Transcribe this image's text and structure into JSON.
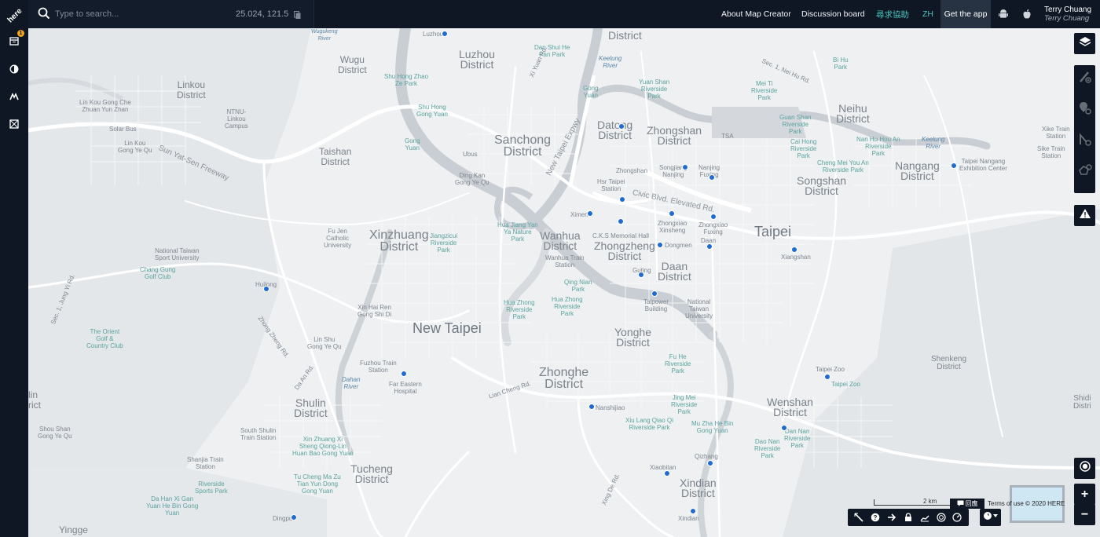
{
  "brand": {
    "logo_text": "here"
  },
  "rail": {
    "items": [
      {
        "icon": "calendar-icon",
        "badge": "1"
      },
      {
        "icon": "contrast-icon"
      },
      {
        "icon": "road-icon"
      },
      {
        "icon": "map-grid-icon"
      }
    ]
  },
  "search": {
    "placeholder": "Type to search...",
    "coords": "25.024, 121.5"
  },
  "nav": {
    "about": "About Map Creator",
    "discussion": "Discussion board",
    "help": "尋求協助",
    "lang": "ZH",
    "get_app": "Get the app"
  },
  "user": {
    "name": "Terry Chuang",
    "subtitle": "Terry Chuang"
  },
  "map": {
    "labels": {
      "district_top": "District",
      "luzhou": "Luzhou\nDistrict",
      "wugu": "Wugu\nDistrict",
      "linkou": "Linkou\nDistrict",
      "taishan": "Taishan\nDistrict",
      "sanchong": "Sanchong\nDistrict",
      "datong": "Datong\nDistrict",
      "zhongshan": "Zhongshan\nDistrict",
      "neihu": "Neihu\nDistrict",
      "nangang": "Nangang\nDistrict",
      "songshan": "Songshan\nDistrict",
      "xinzhuang": "Xinzhuang\nDistrict",
      "wanhua": "Wanhua\nDistrict",
      "zhongzheng": "Zhongzheng\nDistrict",
      "daan": "Daan\nDistrict",
      "taipei": "Taipei",
      "newtaipei": "New Taipei",
      "yonghe": "Yonghe\nDistrict",
      "zhonghe": "Zhonghe\nDistrict",
      "shulin": "Shulin\nDistrict",
      "tucheng": "Tucheng\nDistrict",
      "wenshan": "Wenshan\nDistrict",
      "xindian": "Xindian\nDistrict",
      "yingge": "Yingge",
      "shenkeng": "Shenkeng\nDistrict",
      "shiding": "Shidi\nDistri",
      "edge_left": "lin\nrict",
      "sun_yat_sen": "Sun Yat-Sen Freeway",
      "civic": "Civic Blvd. Elevated Rd.",
      "new_taipei_expwy": "New Taipei Expwy",
      "zhong_zheng_rd": "Zhong Zheng Rd.",
      "da_an_rd": "Da An Rd.",
      "lian_cheng_rd": "Lian Cheng Rd.",
      "sec1_zhongyi": "Sec. 1, Jung Yi Rd.",
      "sec1_neihu": "Sec. 1, Nei Hu Rd.",
      "xi_yuan_rd": "Xi Yuan Rd.",
      "xing_de_rd": "Xing De Rd.",
      "wugukeng": "Wugukeng\nRiver",
      "keelung": "Keelung\nRiver",
      "keelung2": "Keelung\nRiver",
      "dahan": "Dahan\nRiver",
      "lin_kou_gong_che": "Lin Kou Gong Che\nZhuan Yun Zhan",
      "ntnu_linkou": "NTNU-\nLinkou\nCampus",
      "solar_bus": "Solar Bus",
      "lin_kou_gong_ye": "Lin Kou\nGong Ye Qu",
      "shu_hong_zhao": "Shu Hong Zhao\nZe Park",
      "shu_hong_gong": "Shu Hong\nGong Yuan",
      "gong_yuan": "Gong\nYuan",
      "dan_shui_he": "Dan Shui He\nPan Park",
      "luzhou_st": "Luzhou",
      "ubus": "Ubus",
      "ding_kan": "Ding Kan\nGong Ye Qu",
      "gong_yuan2": "Gong\nYuan",
      "yuan_shan": "Yuan Shan\nRiverside\nPark",
      "mei_ti": "Mei Ti\nRiverside\nPark",
      "bi_hu": "Bi Hu\nPark",
      "guan_shan": "Guan Shan\nRiverside\nPark",
      "cai_hong": "Cai Hong\nRiverside\nPark",
      "nan_hu_hou_an": "Nan Hu Hou An\nRiverside\nPark",
      "cheng_mei": "Cheng Mei You An\nRiverside Park",
      "taipei_nangang": "Taipei Nangang\nExhibition Center",
      "xike": "Xike Train\nStation",
      "sike": "Sike Train\nStation",
      "tsa": "TSA",
      "zhongshan_st": "Zhongshan",
      "songjiang": "Songjiang\nNanjing",
      "nanjing_fuxing": "Nanjing\nFuxing",
      "hsr": "Hsr Taipei\nStation",
      "ximen": "Ximen",
      "zhongxiao_xinsheng": "Zhongxiao\nXinsheng",
      "zhongxiao_fuxing": "Zhongxiao\nFuxing",
      "daan_st": "Daan",
      "dongmen": "Dongmen",
      "ck_memorial": "C.K.S Memorial Hall",
      "xiangshan": "Xiangshan",
      "guting": "Guting",
      "taipower": "Taipower\nBuilding",
      "ntu": "National\nTaiwan\nUniversity",
      "hua_jiang": "Hua Jiang Yan\nYa Nature\nPark",
      "jiangzicui": "Jiangzicui\nRiverside\nPark",
      "fu_jen": "Fu Jen\nCatholic\nUniversity",
      "wanhua_train": "Wanhua Train\nStation",
      "qing_nian": "Qing Nian\nPark",
      "hua_zhong_1": "Hua Zhong\nRiverside\nPark",
      "hua_zhong_2": "Hua Zhong\nRiverside\nPark",
      "nat_sport": "National Taiwan\nSport University",
      "chang_gung": "Chang Gung\nGolf Club",
      "huilong": "Huilong",
      "xin_hai_ren": "Xin Hai Ren\nGong Shi Di",
      "lin_shu": "Lin Shu\nGong Ye Qu",
      "orient_golf": "The Orient\nGolf &\nCountry Club",
      "fuzhou_train": "Fuzhou Train\nStation",
      "far_eastern": "Far Eastern\nHospital",
      "shou_shan": "Shou Shan\nGong Ye Qu",
      "south_shulin": "South Shulin\nTrain Station",
      "xin_zhuang_xi": "Xin Zhuang Xi\nSheng Qiong-Lin\nHuan Bao Gong Yuan",
      "shanjia": "Shanjia Train\nStation",
      "riverside_sports": "Riverside\nSports Park",
      "tu_cheng_ma": "Tu Cheng Ma Zu\nTian Yun Dong\nGong Yuan",
      "da_han_xi": "Da Han Xi Gan\nYuan He Bin Gong\nYuan",
      "dingpu": "Dingpu",
      "nanshijiao": "Nanshijiao",
      "fu_he": "Fu He\nRiverside\nPark",
      "jing_mei": "Jing Mei\nRiverside\nPark",
      "xiu_lang": "Xiu Lang Qiao Qi\nRiverside Park",
      "mu_zha": "Mu Zha He Bin\nGong Yuan",
      "dan_nan": "Dan Nan\nRiverside\nPark",
      "dao_nan": "Dao Nan\nRiverside\nPark",
      "taipei_zoo_st": "Taipei Zoo",
      "taipei_zoo": "Taipei Zoo",
      "qizhang": "Qizhang",
      "xiaobitan": "Xiaobitan",
      "xindian_st": "Xindian"
    }
  },
  "controls": {
    "right": [
      "layers-icon",
      "add-road-icon",
      "add-poi-icon",
      "add-node-icon",
      "add-area-icon",
      "warning-icon",
      "locate-icon"
    ],
    "zoom_in": "+",
    "zoom_out": "−",
    "tools": [
      "measure-icon",
      "help-icon",
      "arrow-icon",
      "lock-icon",
      "profile-icon",
      "target-icon",
      "speed-icon"
    ]
  },
  "footer": {
    "scale": "2 km",
    "feedback": "回應",
    "terms": "Terms of use © 2020 HERE"
  },
  "colors": {
    "chrome": "#0f1724",
    "accent_teal": "#46c6c0",
    "map_bg": "#eef0f2",
    "river": "#c9ced4",
    "metro": "#1f6bd1"
  }
}
